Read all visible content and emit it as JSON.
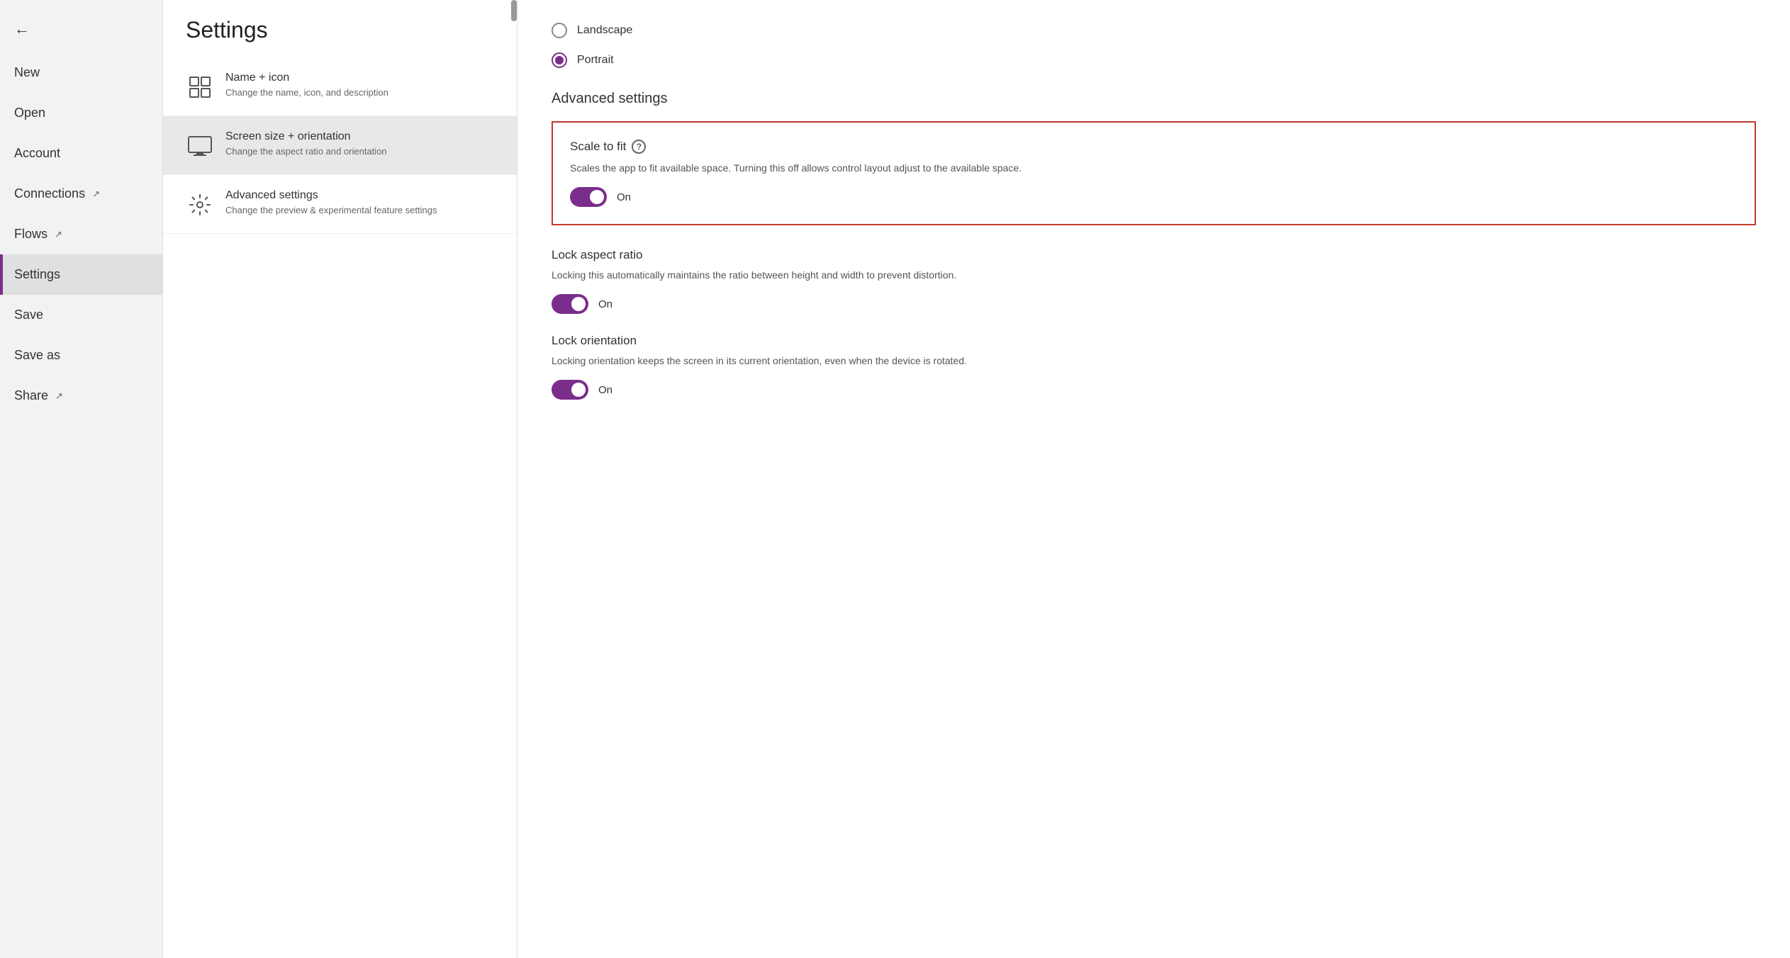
{
  "sidebar": {
    "back_label": "←",
    "items": [
      {
        "id": "new",
        "label": "New",
        "external": false
      },
      {
        "id": "open",
        "label": "Open",
        "external": false
      },
      {
        "id": "account",
        "label": "Account",
        "external": false
      },
      {
        "id": "connections",
        "label": "Connections",
        "external": true
      },
      {
        "id": "flows",
        "label": "Flows",
        "external": true
      },
      {
        "id": "settings",
        "label": "Settings",
        "external": false,
        "active": true
      },
      {
        "id": "save",
        "label": "Save",
        "external": false
      },
      {
        "id": "save-as",
        "label": "Save as",
        "external": false
      },
      {
        "id": "share",
        "label": "Share",
        "external": true
      }
    ]
  },
  "settings": {
    "title": "Settings",
    "items": [
      {
        "id": "name-icon",
        "title": "Name + icon",
        "description": "Change the name, icon, and description",
        "icon": "grid"
      },
      {
        "id": "screen-size",
        "title": "Screen size + orientation",
        "description": "Change the aspect ratio and orientation",
        "icon": "monitor",
        "active": true
      },
      {
        "id": "advanced",
        "title": "Advanced settings",
        "description": "Change the preview & experimental feature settings",
        "icon": "gear"
      }
    ]
  },
  "content": {
    "orientation": {
      "options": [
        {
          "id": "landscape",
          "label": "Landscape",
          "selected": false
        },
        {
          "id": "portrait",
          "label": "Portrait",
          "selected": true
        }
      ]
    },
    "advanced_settings_title": "Advanced settings",
    "scale_to_fit": {
      "title": "Scale to fit",
      "description": "Scales the app to fit available space. Turning this off allows control layout adjust to the available space.",
      "toggle_label": "On",
      "enabled": true
    },
    "lock_aspect_ratio": {
      "title": "Lock aspect ratio",
      "description": "Locking this automatically maintains the ratio between height and width to prevent distortion.",
      "toggle_label": "On",
      "enabled": true
    },
    "lock_orientation": {
      "title": "Lock orientation",
      "description": "Locking orientation keeps the screen in its current orientation, even when the device is rotated.",
      "toggle_label": "On",
      "enabled": true
    }
  }
}
